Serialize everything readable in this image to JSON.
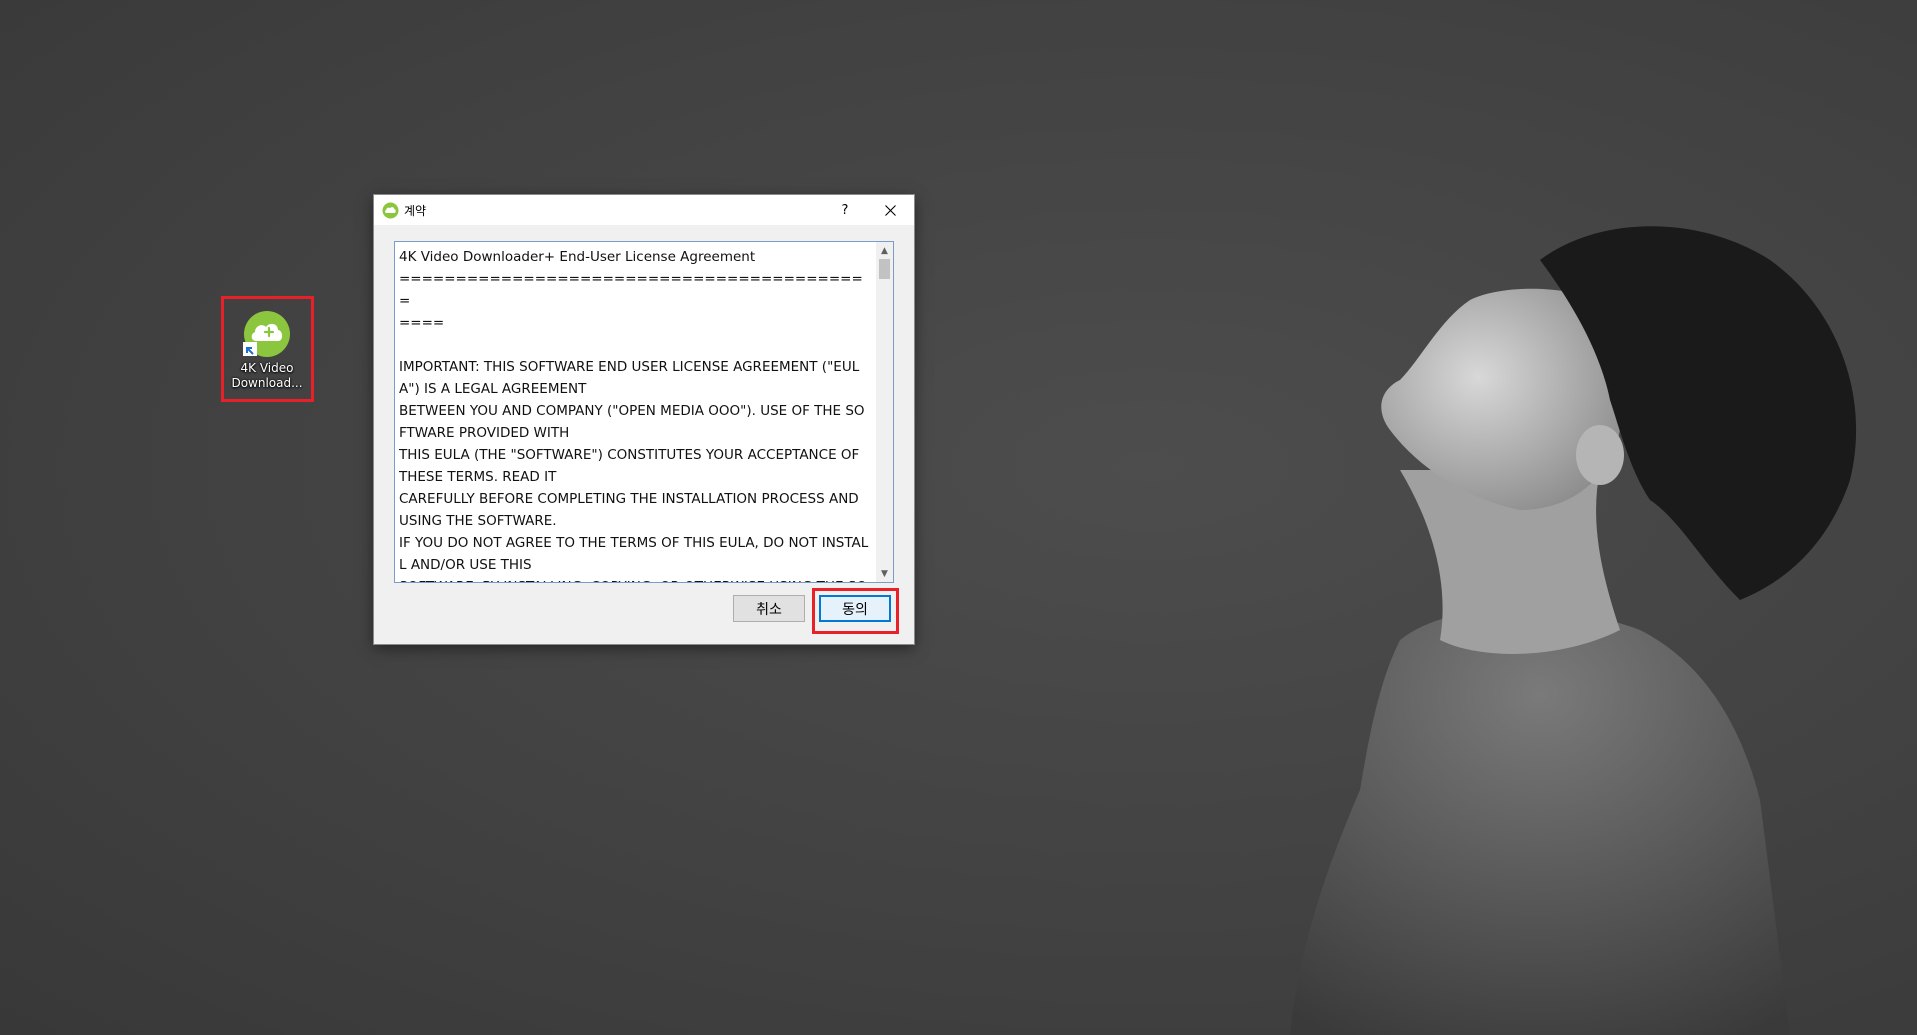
{
  "desktop": {
    "icon": {
      "label_line1": "4K Video",
      "label_line2": "Download...",
      "icon": "4k-video-downloader-app-icon"
    },
    "highlight_color": "#e8202a"
  },
  "dialog": {
    "title": "계약",
    "help_label": "?",
    "close_label": "✕",
    "license_text": "4K Video Downloader+ End-User License Agreement\n==========================================\n====\n\nIMPORTANT: THIS SOFTWARE END USER LICENSE AGREEMENT (\"EULA\") IS A LEGAL AGREEMENT\nBETWEEN YOU AND COMPANY (\"OPEN MEDIA OOO\"). USE OF THE SOFTWARE PROVIDED WITH\nTHIS EULA (THE \"SOFTWARE\") CONSTITUTES YOUR ACCEPTANCE OF THESE TERMS. READ IT\nCAREFULLY BEFORE COMPLETING THE INSTALLATION PROCESS AND USING THE SOFTWARE.\nIF YOU DO NOT AGREE TO THE TERMS OF THIS EULA, DO NOT INSTALL AND/OR USE THIS\nSOFTWARE. BY INSTALLING, COPYING, OR OTHERWISE USING THE SOFTWARE PRODUCT, YOU",
    "cancel_label": "취소",
    "agree_label": "동의",
    "accent_color": "#0078d7",
    "app_icon_color": "#8cc63f"
  }
}
